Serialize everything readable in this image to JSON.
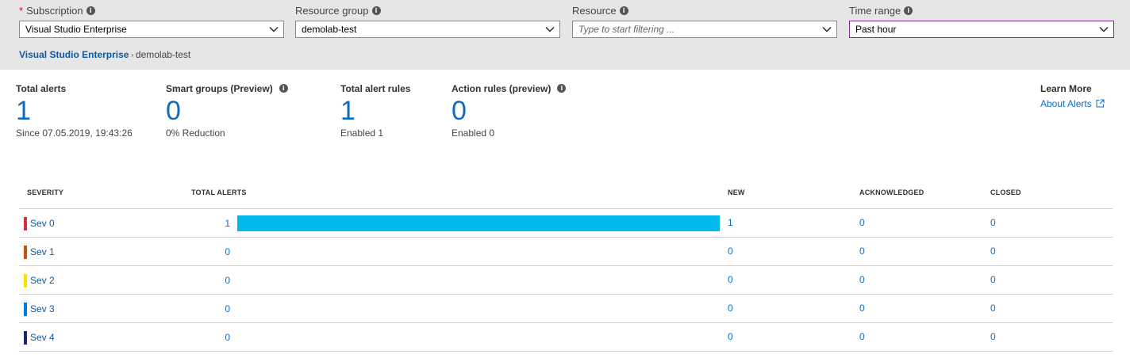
{
  "filters": {
    "subscription": {
      "label": "Subscription",
      "required": true,
      "value": "Visual Studio Enterprise"
    },
    "resource_group": {
      "label": "Resource group",
      "value": "demolab-test"
    },
    "resource": {
      "label": "Resource",
      "placeholder": "Type to start filtering ..."
    },
    "time_range": {
      "label": "Time range",
      "value": "Past hour"
    }
  },
  "breadcrumb": {
    "link": "Visual Studio Enterprise",
    "current": "demolab-test"
  },
  "summary": {
    "total_alerts": {
      "title": "Total alerts",
      "value": "1",
      "sub": "Since 07.05.2019, 19:43:26"
    },
    "smart_groups": {
      "title": "Smart groups (Preview)",
      "value": "0",
      "sub": "0% Reduction"
    },
    "total_alert_rules": {
      "title": "Total alert rules",
      "value": "1",
      "sub": "Enabled 1"
    },
    "action_rules": {
      "title": "Action rules (preview)",
      "value": "0",
      "sub": "Enabled 0"
    }
  },
  "learn_more": {
    "title": "Learn More",
    "link": "About Alerts"
  },
  "table": {
    "headers": {
      "severity": "SEVERITY",
      "total": "TOTAL ALERTS",
      "new": "NEW",
      "acknowledged": "ACKNOWLEDGED",
      "closed": "CLOSED"
    },
    "max_total": 1,
    "rows": [
      {
        "severity": "Sev 0",
        "color": "#d13438",
        "total": "1",
        "new": "1",
        "acknowledged": "0",
        "closed": "0"
      },
      {
        "severity": "Sev 1",
        "color": "#ca5010",
        "total": "0",
        "new": "0",
        "acknowledged": "0",
        "closed": "0"
      },
      {
        "severity": "Sev 2",
        "color": "#fce100",
        "total": "0",
        "new": "0",
        "acknowledged": "0",
        "closed": "0"
      },
      {
        "severity": "Sev 3",
        "color": "#0078d4",
        "total": "0",
        "new": "0",
        "acknowledged": "0",
        "closed": "0"
      },
      {
        "severity": "Sev 4",
        "color": "#1a237e",
        "total": "0",
        "new": "0",
        "acknowledged": "0",
        "closed": "0"
      }
    ]
  },
  "colors": {
    "accent": "#0f6cbd",
    "bar": "#00b7ee",
    "focus_border": "#7a2e86"
  }
}
